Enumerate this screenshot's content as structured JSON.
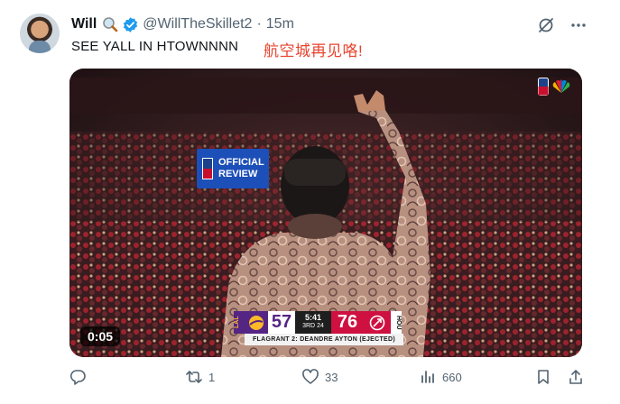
{
  "tweet": {
    "name": "Will",
    "handle": "@WillTheSkillet2",
    "separator": "·",
    "time": "15m",
    "text": "SEE YALL IN HTOWNNNN",
    "overlay_text": "航空城再见咯!"
  },
  "video": {
    "duration": "0:05",
    "review_line1": "OFFICIAL",
    "review_line2": "REVIEW",
    "scorebug": {
      "away_tag": "LAL",
      "away_score": "57",
      "clock": "5:41",
      "quarter": "3RD",
      "shot_clock": "24",
      "home_score": "76",
      "home_tag": "HOU",
      "caption": "FLAGRANT 2:  DEANDRE AYTON (EJECTED)"
    }
  },
  "actions": {
    "reposts": "1",
    "likes": "33",
    "views": "660"
  },
  "icons": {
    "emoji": "magnifying-glass-icon",
    "verified": "verified-badge-icon",
    "grok": "grok-icon",
    "more": "more-icon",
    "reply": "reply-icon",
    "repost": "repost-icon",
    "like": "heart-icon",
    "views": "views-icon",
    "bookmark": "bookmark-icon",
    "share": "share-icon"
  },
  "colors": {
    "accent": "#1d9bf0",
    "overlay_text": "#e8442f",
    "muted": "#536471"
  }
}
